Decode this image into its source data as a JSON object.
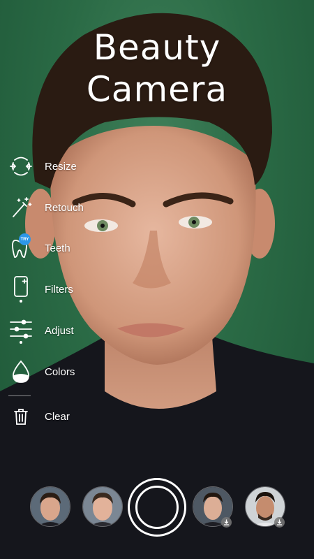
{
  "app": {
    "title": "Beauty Camera"
  },
  "menu": [
    {
      "label": "Resize",
      "icon": "resize-face-icon"
    },
    {
      "label": "Retouch",
      "icon": "magic-wand-icon"
    },
    {
      "label": "Teeth",
      "icon": "tooth-icon",
      "badge": "TRY"
    },
    {
      "label": "Filters",
      "icon": "phone-sparkle-icon"
    },
    {
      "label": "Adjust",
      "icon": "sliders-icon"
    },
    {
      "label": "Colors",
      "icon": "drop-icon"
    },
    {
      "label": "Clear",
      "icon": "trash-icon"
    }
  ],
  "colors": {
    "background": "#2a6a45",
    "accent": "#2d97e8",
    "text": "#ffffff"
  },
  "presets": [
    {
      "name": "preset-face-1",
      "download": false
    },
    {
      "name": "preset-face-2",
      "download": false
    },
    {
      "name": "preset-face-3",
      "download": true
    },
    {
      "name": "preset-face-4",
      "download": true
    }
  ]
}
